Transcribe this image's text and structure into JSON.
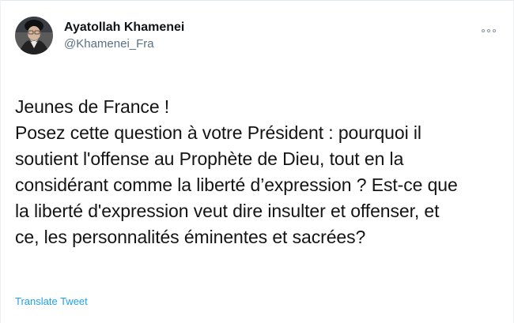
{
  "tweet": {
    "author": {
      "display_name": "Ayatollah Khamenei",
      "handle": "@Khamenei_Fra",
      "avatar_icon": "profile-photo"
    },
    "more_icon": "more-options-icon",
    "text_lines": [
      "Jeunes de France !",
      "Posez cette question à votre Président : pourquoi il",
      "soutient l'offense au Prophète de Dieu, tout en la",
      "considérant comme la liberté d’expression ? Est-ce que",
      "la liberté d'expression veut dire insulter et offenser, et",
      "ce, les personnalités éminentes et sacrées?"
    ],
    "translate_label": "Translate Tweet"
  },
  "colors": {
    "link": "#1da1f2",
    "handle": "#5b7083",
    "text": "#141414"
  }
}
